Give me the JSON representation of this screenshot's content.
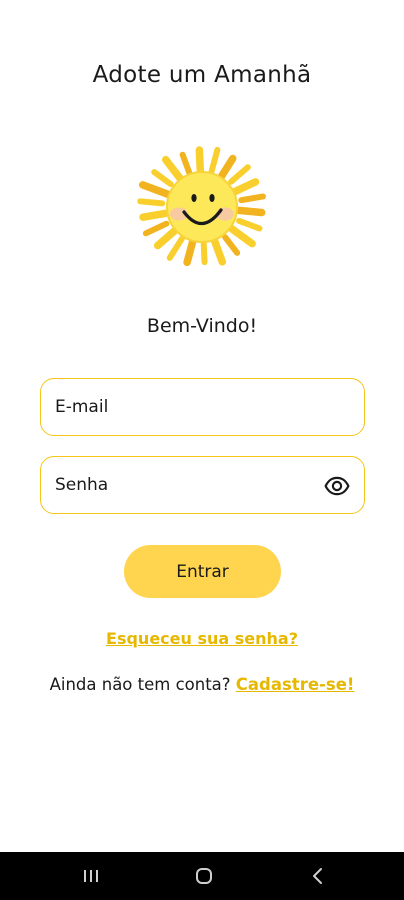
{
  "app": {
    "title": "Adote um Amanhã",
    "logo_icon": "sun-smiley-icon",
    "colors": {
      "accent": "#ffd54f",
      "border": "#f5c518",
      "link": "#e6b800",
      "navbar": "#000000"
    }
  },
  "login": {
    "welcome": "Bem-Vindo!",
    "email_placeholder": "E-mail",
    "password_placeholder": "Senha",
    "password_toggle_icon": "eye-icon",
    "submit_label": "Entrar",
    "forgot_label": "Esqueceu sua senha?",
    "no_account_label": "Ainda não tem conta?",
    "signup_label": "Cadastre-se!"
  },
  "system_nav": {
    "recents_icon": "recents-icon",
    "home_icon": "home-icon",
    "back_icon": "back-icon"
  }
}
